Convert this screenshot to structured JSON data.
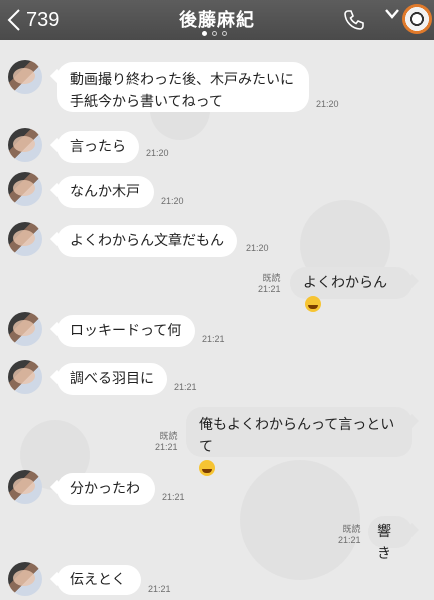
{
  "header": {
    "back_count": "739",
    "title": "後藤麻紀"
  },
  "messages": [
    {
      "side": "left",
      "lines": [
        "動画撮り終わった後、木戸みたいに",
        "手紙今から書いてねって"
      ],
      "time": "21:20"
    },
    {
      "side": "left",
      "lines": [
        "言ったら"
      ],
      "time": "21:20"
    },
    {
      "side": "left",
      "lines": [
        "なんか木戸"
      ],
      "time": "21:20"
    },
    {
      "side": "left",
      "lines": [
        "よくわからん文章だもん"
      ],
      "time": "21:20"
    },
    {
      "side": "right",
      "lines": [
        "よくわからん"
      ],
      "emoji": "laughing-tears-emoji",
      "read": "既読",
      "time": "21:21"
    },
    {
      "side": "left",
      "lines": [
        "ロッキードって何"
      ],
      "time": "21:21"
    },
    {
      "side": "left",
      "lines": [
        "調べる羽目に"
      ],
      "time": "21:21"
    },
    {
      "side": "right",
      "lines": [
        "俺もよくわからんって言っといて"
      ],
      "emoji": "laughing-tears-emoji",
      "read": "既読",
      "time": "21:21"
    },
    {
      "side": "left",
      "lines": [
        "分かったわ"
      ],
      "time": "21:21"
    },
    {
      "side": "right",
      "lines": [
        "響き"
      ],
      "read": "既読",
      "time": "21:21"
    },
    {
      "side": "left",
      "lines": [
        "伝えとく"
      ],
      "time": "21:21"
    }
  ]
}
